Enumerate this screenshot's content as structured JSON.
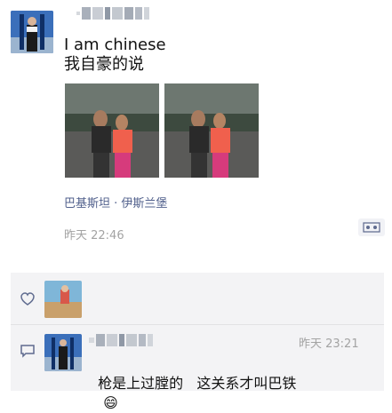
{
  "post": {
    "text_line1": "I am chinese",
    "text_line2": "我自豪的说",
    "location": "巴基斯坦 · 伊斯兰堡",
    "time": "昨天 22:46"
  },
  "comment": {
    "time": "昨天 23:21",
    "text": "枪是上过膛的   这关系才叫巴铁",
    "emoji": "😄"
  },
  "icons": {
    "comment_button": "comment-bubble-icon",
    "like": "heart-outline-icon",
    "comment": "speech-bubble-icon"
  },
  "colors": {
    "location_link": "#51608c",
    "comment_bg": "#f3f3f5"
  }
}
